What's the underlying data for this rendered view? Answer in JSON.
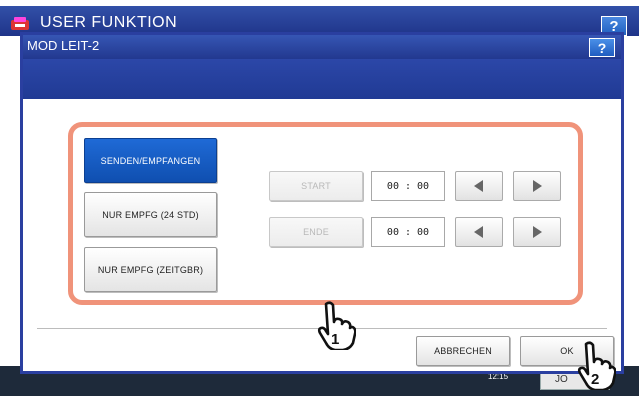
{
  "background": {
    "title": "USER FUNKTION",
    "help_label": "?",
    "time": "12:15",
    "jobs_label": "JO"
  },
  "dialog": {
    "title": "MOD LEIT-2",
    "help_label": "?"
  },
  "mode_buttons": [
    {
      "label": "SENDEN/EMPFANGEN",
      "selected": true
    },
    {
      "label": "NUR EMPFG (24 STD)",
      "selected": false
    },
    {
      "label": "NUR EMPFG (ZEITGBR)",
      "selected": false
    }
  ],
  "time_rows": {
    "start": {
      "label": "START",
      "value": "00 : 00"
    },
    "end": {
      "label": "ENDE",
      "value": "00 : 00"
    }
  },
  "footer": {
    "cancel_label": "ABBRECHEN",
    "ok_label": "OK"
  },
  "callouts": {
    "step1": "1",
    "step2": "2"
  },
  "colors": {
    "title_bar": "#2a3fa0",
    "selected_button": "#1259c4",
    "highlight": "#f0937a"
  },
  "icons": [
    "left-arrow-icon",
    "right-arrow-icon",
    "pointing-hand-icon",
    "help-icon",
    "logo-icon"
  ]
}
